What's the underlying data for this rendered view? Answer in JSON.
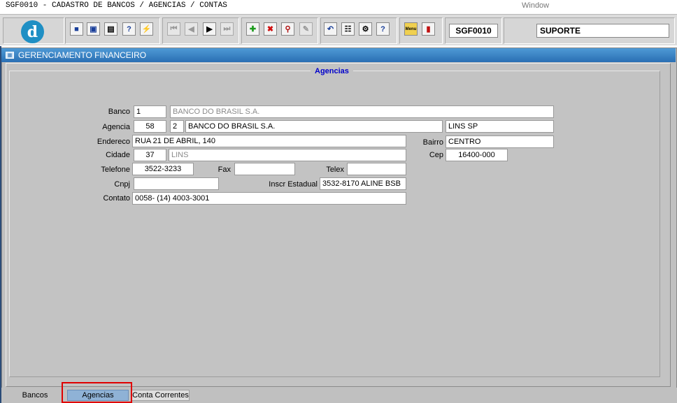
{
  "window": {
    "title": "SGF0010 - CADASTRO DE BANCOS / AGENCIAS / CONTAS",
    "menu_window": "Window"
  },
  "toolbar": {
    "logo_letter": "d",
    "form_code": "SGF0010",
    "user": "SUPORTE",
    "menu_icon_label": "Menu"
  },
  "form": {
    "window_title": "GERENCIAMENTO FINANCEIRO",
    "section_title": "Agencias",
    "labels": {
      "banco": "Banco",
      "agencia": "Agencia",
      "endereco": "Endereco",
      "bairro": "Bairro",
      "cidade": "Cidade",
      "cep": "Cep",
      "telefone": "Telefone",
      "fax": "Fax",
      "telex": "Telex",
      "cnpj": "Cnpj",
      "inscr_estadual": "Inscr Estadual",
      "contato": "Contato"
    },
    "values": {
      "banco_codigo": "1",
      "banco_nome": "BANCO DO BRASIL S.A.",
      "agencia_codigo": "58",
      "agencia_digito": "2",
      "agencia_nome": "BANCO DO BRASIL S.A.",
      "agencia_local": "LINS SP",
      "endereco": "RUA 21 DE ABRIL, 140",
      "bairro": "CENTRO",
      "cidade_codigo": "37",
      "cidade_nome": "LINS",
      "cep": "16400-000",
      "telefone": "3522-3233",
      "fax": "",
      "telex": "",
      "cnpj": "",
      "inscr_estadual": "3532-8170 ALINE BSB",
      "contato": "0058- (14) 4003-3001"
    }
  },
  "tabs": [
    {
      "label": "Bancos"
    },
    {
      "label": "Agencias"
    },
    {
      "label": "Conta Correntes"
    }
  ],
  "colors": {
    "title_bar": "#2a6fb3",
    "section_title": "#0000cc",
    "active_tab": "#8fb2d6",
    "highlight": "#e00000"
  }
}
